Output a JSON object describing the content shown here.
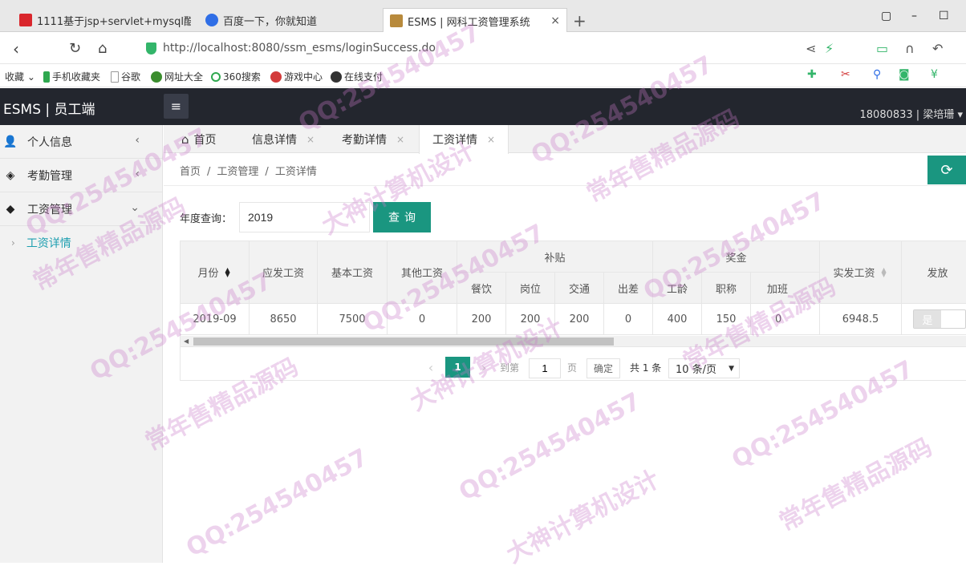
{
  "browser": {
    "tabs": [
      {
        "title": "1111基于jsp+servlet+mysql酷",
        "favicon_color": "#d9262c"
      },
      {
        "title": "百度一下，你就知道",
        "favicon_color": "#2f6ee6",
        "close": "×"
      },
      {
        "title": "ESMS | 网科工资管理系统",
        "favicon_color": "#b88a3c",
        "close": "×"
      }
    ],
    "new_tab": "+",
    "window_controls": [
      "▢",
      "–",
      "☐"
    ],
    "url_host": "http://localhost",
    "url_rest": ":8080/ssm_esms/loginSuccess.do"
  },
  "bookmarks": [
    "收藏",
    "手机收藏夹",
    "谷歌",
    "网址大全",
    "360搜索",
    "游戏中心",
    "在线支付"
  ],
  "app": {
    "logo": "ESMS | 员工端",
    "user": "18080833 | 梁培珊",
    "menu_icon": "≡"
  },
  "sidebar": {
    "items": [
      {
        "label": "个人信息",
        "icon": "user-icon",
        "glyph": "👤",
        "arrow": "‹"
      },
      {
        "label": "考勤管理",
        "icon": "layers-icon",
        "glyph": "◈",
        "arrow": "‹"
      },
      {
        "label": "工资管理",
        "icon": "tag-icon",
        "glyph": "◆",
        "arrow": "⌄"
      }
    ],
    "subitems": [
      {
        "label": "工资详情",
        "chev": "›"
      }
    ]
  },
  "content_tabs": [
    {
      "label": "首页",
      "icon": "home-icon",
      "glyph": "⌂"
    },
    {
      "label": "信息详情",
      "close": "×"
    },
    {
      "label": "考勤详情",
      "close": "×"
    },
    {
      "label": "工资详情",
      "close": "×",
      "active": true
    }
  ],
  "breadcrumb": [
    "首页",
    "/",
    "工资管理",
    "/",
    "工资详情"
  ],
  "refresh_glyph": "⟳",
  "search": {
    "label": "年度查询：",
    "value": "2019",
    "button": "查询"
  },
  "table": {
    "headers": {
      "month": "月份",
      "gross": "应发工资",
      "base": "基本工资",
      "other": "其他工资",
      "allowance": "补贴",
      "bonus": "奖金",
      "net": "实发工资",
      "issued": "发放"
    },
    "sub_headers": [
      "餐饮",
      "岗位",
      "交通",
      "出差",
      "工龄",
      "职称",
      "加班"
    ],
    "rows": [
      {
        "month": "2019-09",
        "gross": "8650",
        "base": "7500",
        "other": "0",
        "cells": [
          "200",
          "200",
          "200",
          "0",
          "400",
          "150",
          "0"
        ],
        "net": "6948.5",
        "issued": "是"
      }
    ]
  },
  "pagination": {
    "prev": "‹",
    "next": "›",
    "current": "1",
    "goto_label": "到第",
    "goto_value": "1",
    "page_label": "页",
    "confirm": "确定",
    "total": "共 1 条",
    "page_size": "10 条/页",
    "dropdown": "▼"
  },
  "watermarks": [
    "QQ:254540457",
    "常年售精品源码",
    "大神计算机设计"
  ]
}
